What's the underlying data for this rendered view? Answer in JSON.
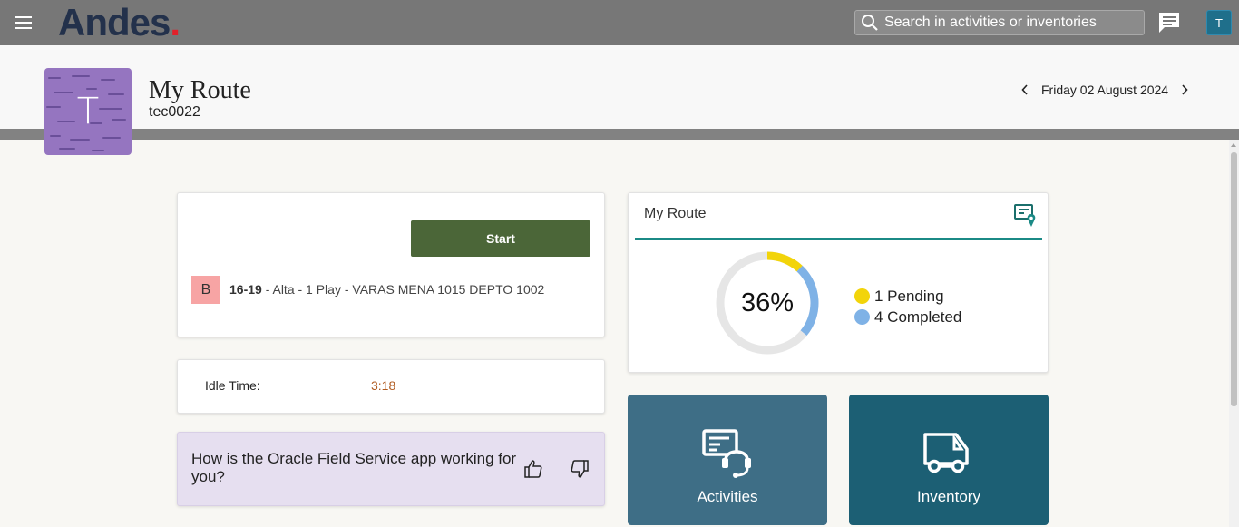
{
  "topbar": {
    "logo": "Andes",
    "logo_dot": ".",
    "search_placeholder": "Search in activities or inventories",
    "user_initial": "T",
    "icons": [
      "hamburger-menu-icon",
      "search-icon",
      "chat-icon"
    ]
  },
  "header": {
    "avatar_initial": "T",
    "title": "My Route",
    "subtitle": "tec0022",
    "date": "Friday 02 August 2024"
  },
  "start_card": {
    "button_label": "Start",
    "activity": {
      "badge": "B",
      "time": "16-19",
      "details": " - Alta - 1 Play - VARAS MENA 1015 DEPTO 1002"
    }
  },
  "idle": {
    "label": "Idle Time:",
    "value": "3:18"
  },
  "feedback": {
    "question": "How is the Oracle Field Service app working for you?"
  },
  "route_card": {
    "title": "My Route",
    "progress_percent": "36%",
    "progress_fraction": 0.36,
    "legend": [
      {
        "label": "1 Pending",
        "color": "#f2d40a"
      },
      {
        "label": "4 Completed",
        "color": "#7fb2e6"
      }
    ]
  },
  "tiles": {
    "activities_label": "Activities",
    "inventory_label": "Inventory"
  },
  "colors": {
    "topbar": "#777777",
    "start_button": "#4b6638",
    "accent_rule": "#1b8a86",
    "pending": "#f2d40a",
    "completed": "#7fb2e6",
    "activities_tile": "#3e6e86",
    "inventory_tile": "#1c5f74"
  }
}
